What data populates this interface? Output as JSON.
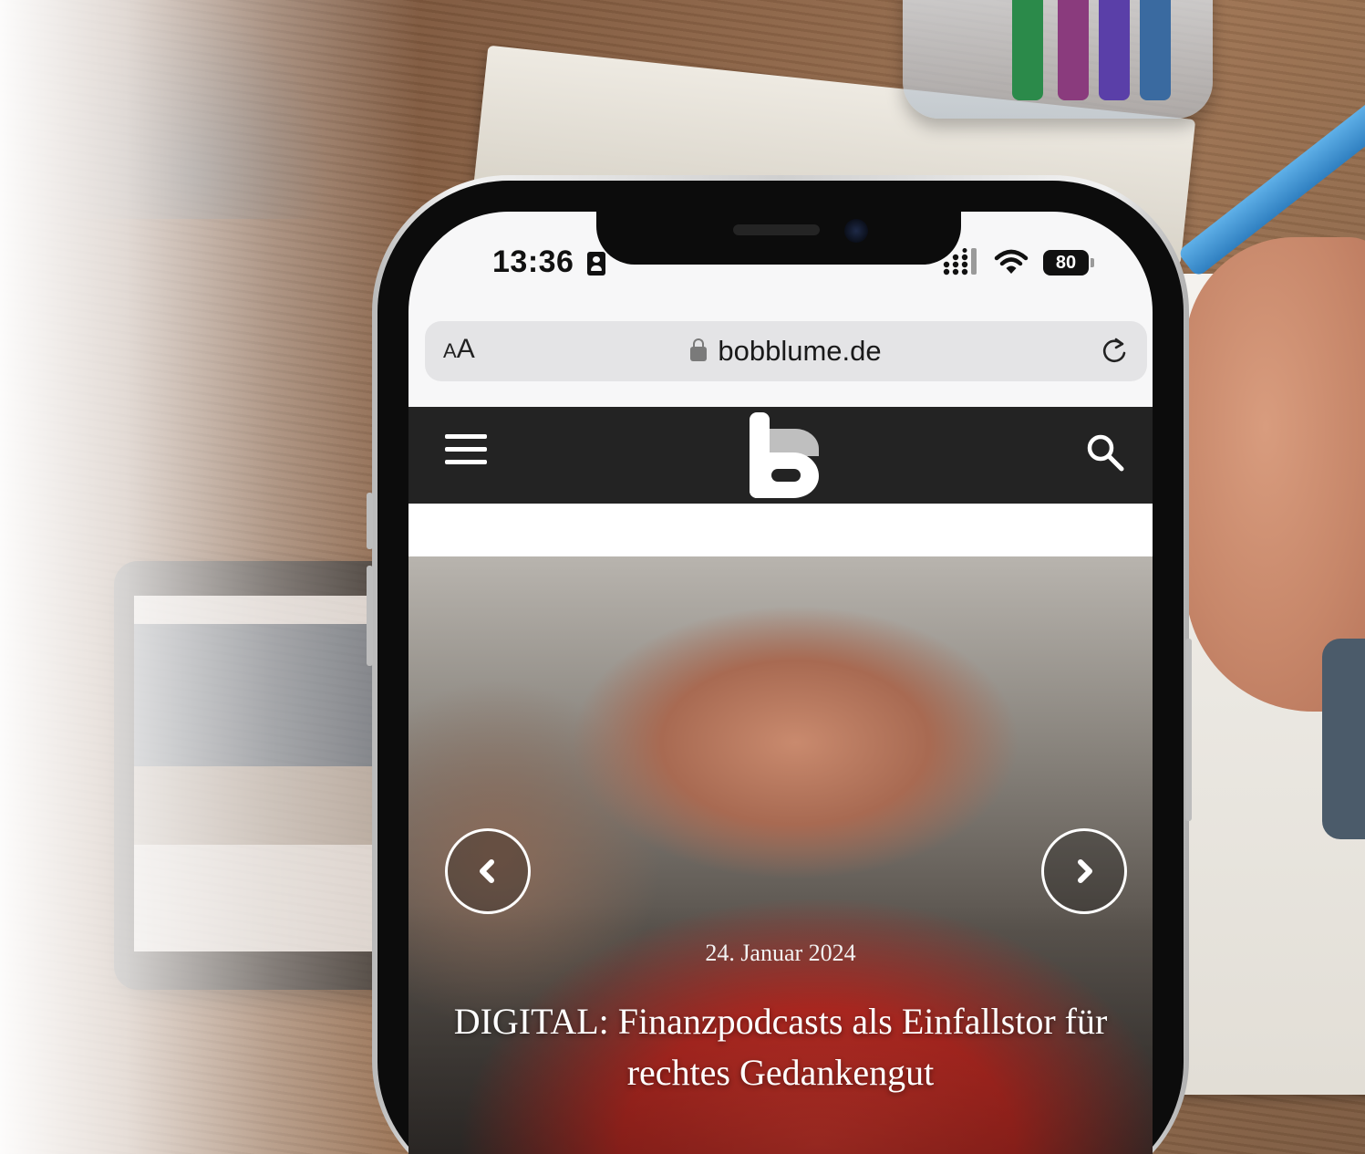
{
  "status_bar": {
    "time": "13:36",
    "battery": "80"
  },
  "browser": {
    "text_size_label_small": "A",
    "text_size_label_large": "A",
    "url": "bobblume.de"
  },
  "article": {
    "date": "24. Januar 2024",
    "title": "DIGITAL: Finanzpodcasts als Einfallstor für rechtes Gedankengut"
  },
  "colors": {
    "site_header": "#232323",
    "address_bar": "#e4e4e6"
  },
  "icons": [
    "id-card-icon",
    "signal-icon",
    "wifi-icon",
    "lock-icon",
    "reload-icon",
    "menu-icon",
    "search-icon",
    "chevron-left-icon",
    "chevron-right-icon"
  ]
}
